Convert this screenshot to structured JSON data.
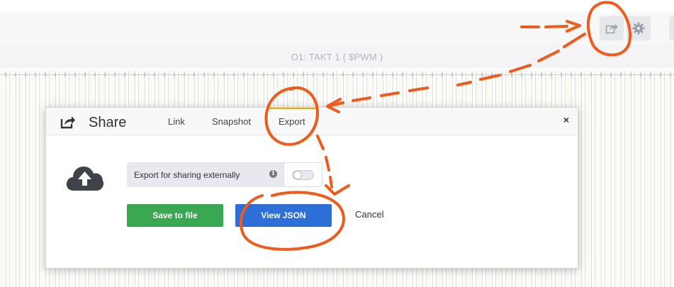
{
  "panel": {
    "title": "O1: TAKT 1 ( $PWM )"
  },
  "toolbar": {
    "share_icon": "share-icon",
    "settings_icon": "gear-icon"
  },
  "modal": {
    "title": "Share",
    "tabs": [
      {
        "label": "Link",
        "active": false
      },
      {
        "label": "Snapshot",
        "active": false
      },
      {
        "label": "Export",
        "active": true
      }
    ],
    "close_label": "×",
    "export_toggle": {
      "label": "Export for sharing externally",
      "info_icon": "i",
      "enabled": false
    },
    "buttons": {
      "save": "Save to file",
      "view_json": "View JSON",
      "cancel": "Cancel"
    }
  },
  "colors": {
    "accent_tab": "#f2a900",
    "save_button": "#3aa853",
    "view_json_button": "#2d6fd6",
    "annotation": "#f05a1a"
  }
}
